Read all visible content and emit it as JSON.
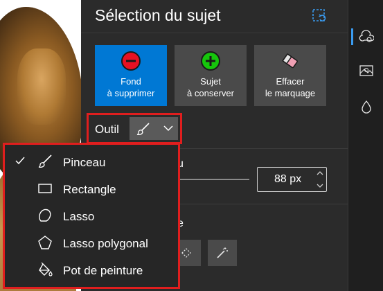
{
  "panel": {
    "title": "Sélection du sujet",
    "modes": [
      {
        "line1": "Fond",
        "line2": "à supprimer",
        "icon": "minus-circle-icon",
        "color": "#e81123",
        "active": true
      },
      {
        "line1": "Sujet",
        "line2": "à conserver",
        "icon": "plus-circle-icon",
        "color": "#16c60c",
        "active": false
      },
      {
        "line1": "Effacer",
        "line2": "le marquage",
        "icon": "eraser-icon",
        "active": false
      }
    ],
    "tool": {
      "label": "Outil",
      "selected_icon": "brush-icon"
    },
    "size": {
      "label_partial": "u",
      "value": "88 px"
    },
    "mode_label_partial": "e"
  },
  "menu": {
    "items": [
      {
        "label": "Pinceau",
        "icon": "brush-icon",
        "checked": true
      },
      {
        "label": "Rectangle",
        "icon": "rectangle-icon",
        "checked": false
      },
      {
        "label": "Lasso",
        "icon": "lasso-icon",
        "checked": false
      },
      {
        "label": "Lasso polygonal",
        "icon": "polygon-lasso-icon",
        "checked": false
      },
      {
        "label": "Pot de peinture",
        "icon": "paint-bucket-icon",
        "checked": false
      }
    ]
  },
  "rail": {
    "items": [
      {
        "icon": "subject-select-icon",
        "active": true
      },
      {
        "icon": "background-image-icon",
        "active": false
      },
      {
        "icon": "color-drop-icon",
        "active": false
      }
    ]
  },
  "colors": {
    "accent": "#0078d4",
    "highlight": "#e01e1e",
    "panel": "#2b2b2b",
    "button": "#4a4a4a"
  }
}
